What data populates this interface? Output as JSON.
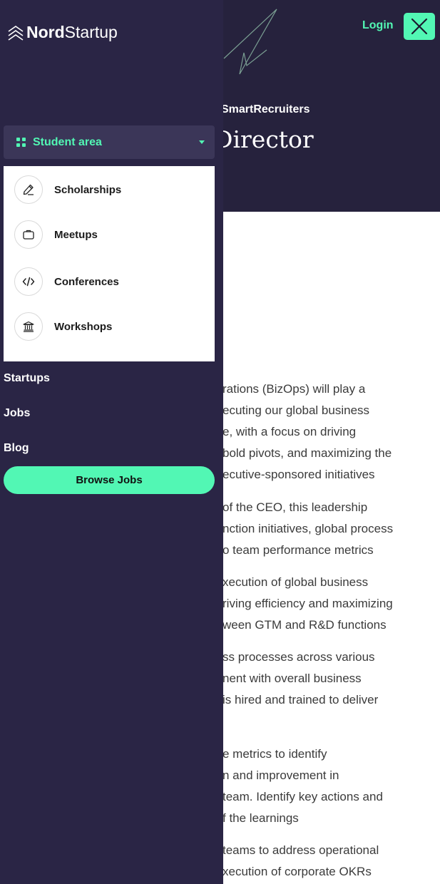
{
  "header": {
    "login_label": "Login",
    "close_icon": "close-icon"
  },
  "job": {
    "company": "SmartRecruiters",
    "title_fragment": "Director"
  },
  "description": {
    "paragraphs": [
      [
        "rations (BizOps) will play a",
        "ecuting our global business",
        "e, with a focus on driving",
        "bold pivots, and maximizing the",
        "ecutive-sponsored initiatives"
      ],
      [
        " of the CEO, this leadership",
        "nction initiatives, global process",
        "o team performance metrics"
      ],
      [
        "xecution of global business",
        "riving efficiency and maximizing",
        "ween GTM and R&D functions"
      ],
      [
        "ss processes across various",
        "nent with overall business",
        " is hired and trained to deliver"
      ],
      [
        "e metrics to identify",
        "n and improvement in",
        " team. Identify key actions and",
        "f the learnings"
      ],
      [
        " teams to address operational",
        "xecution of corporate OKRs"
      ]
    ]
  },
  "sidebar": {
    "logo": {
      "part1": "Nord",
      "part2": "Startup"
    },
    "dropdown": {
      "label": "Student area",
      "icon": "grid-icon"
    },
    "submenu": [
      {
        "label": "Scholarships",
        "icon": "pencil-icon"
      },
      {
        "label": "Meetups",
        "icon": "briefcase-icon"
      },
      {
        "label": "Conferences",
        "icon": "code-icon"
      },
      {
        "label": "Workshops",
        "icon": "institution-icon"
      }
    ],
    "links": [
      {
        "label": "Startups"
      },
      {
        "label": "Jobs"
      },
      {
        "label": "Blog"
      }
    ],
    "cta_label": "Browse Jobs"
  },
  "colors": {
    "accent": "#52f7b4",
    "sidebar_bg": "#2a2545",
    "hero_bg": "#26223d",
    "dropdown_bg": "#3b3658"
  }
}
